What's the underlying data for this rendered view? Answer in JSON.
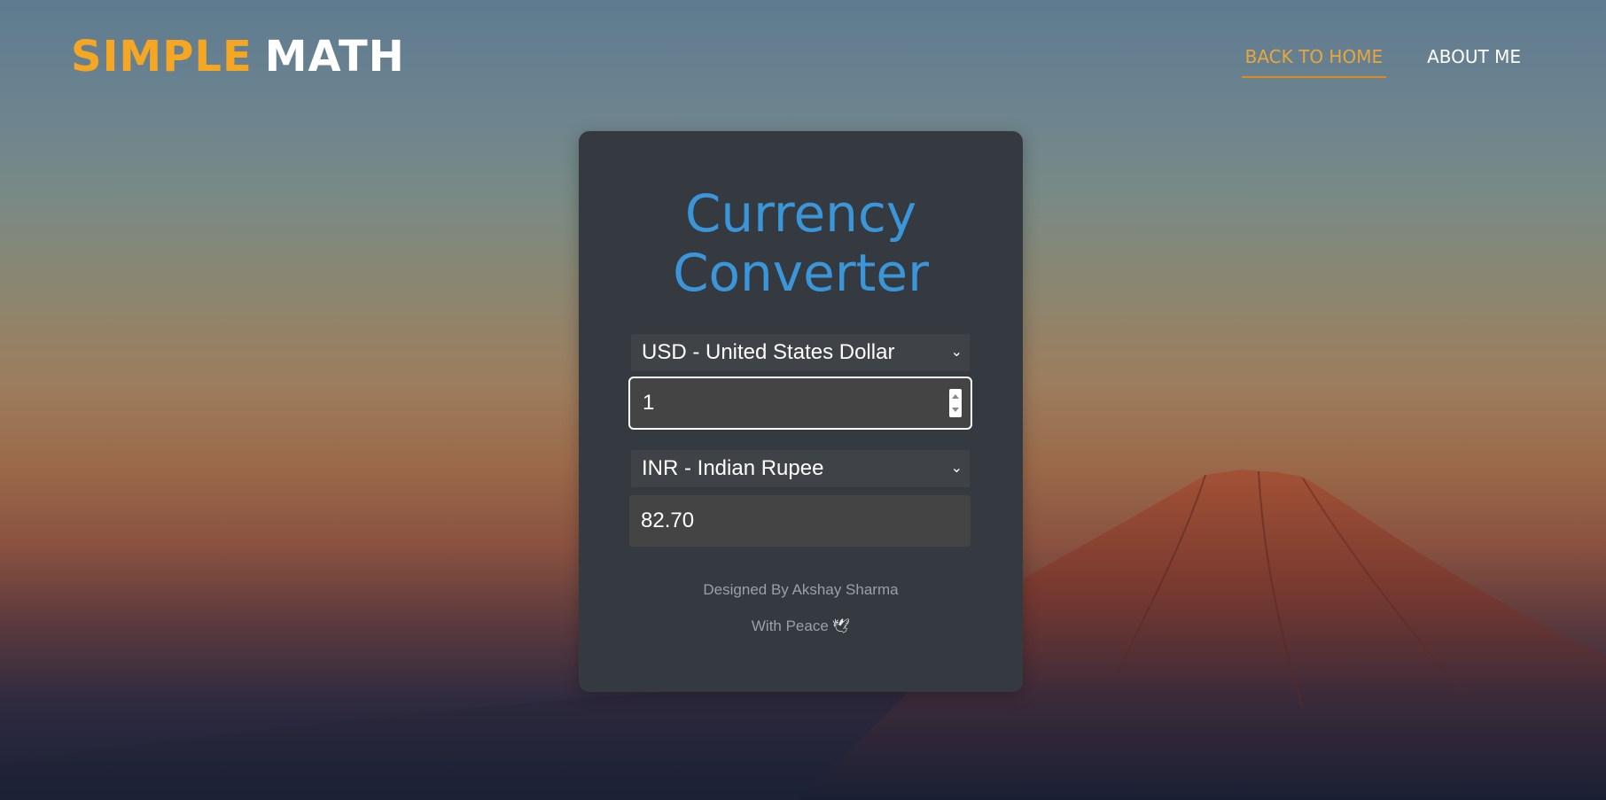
{
  "brand": {
    "part1": "SIMPLE",
    "part2": "MATH"
  },
  "nav": {
    "items": [
      {
        "label": "BACK TO HOME",
        "active": true
      },
      {
        "label": "ABOUT ME",
        "active": false
      }
    ]
  },
  "converter": {
    "title_line1": "Currency",
    "title_line2": "Converter",
    "from_currency": "USD - United States Dollar",
    "amount": "1",
    "to_currency": "INR - Indian Rupee",
    "result": "82.70"
  },
  "footer": {
    "credit": "Designed By Akshay Sharma",
    "tagline": "With Peace"
  },
  "colors": {
    "accent_orange": "#f5a623",
    "title_blue": "#3a96d9",
    "card_bg": "#343a40"
  },
  "icons": {
    "chevron": "chevron-down-icon",
    "dove": "dove-icon"
  }
}
